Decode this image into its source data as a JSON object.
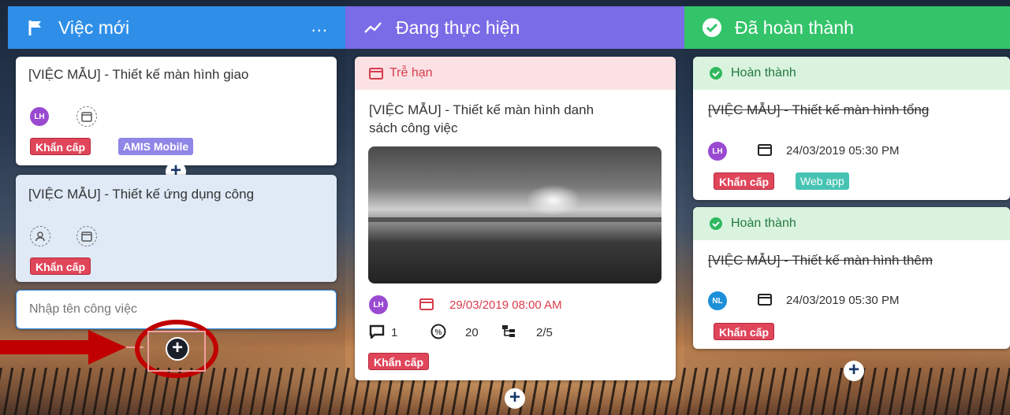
{
  "columns": [
    {
      "title": "Việc mới",
      "icon": "flag-icon",
      "more": "..."
    },
    {
      "title": "Đang thực hiện",
      "icon": "trend-icon"
    },
    {
      "title": "Đã hoàn thành",
      "icon": "check-circle-icon"
    }
  ],
  "new": {
    "card1": {
      "title": "[VIỆC MẪU] - Thiết kế màn hình giao",
      "avatar": "LH",
      "tags": [
        "Khẩn cấp",
        "AMIS Mobile"
      ]
    },
    "card2": {
      "title": "[VIỆC MẪU] - Thiết kế ứng dụng công",
      "tags": [
        "Khẩn cấp"
      ]
    },
    "input_placeholder": "Nhập tên công việc"
  },
  "progress": {
    "status": "Trễ hạn",
    "title_line1": "[VIỆC MẪU] - Thiết kế màn hình danh",
    "title_line2": "sách công việc",
    "avatar": "LH",
    "due": "29/03/2019 08:00 AM",
    "comments": "1",
    "percent": "20",
    "subtasks": "2/5",
    "tag": "Khẩn cấp"
  },
  "done": {
    "card1": {
      "status": "Hoàn thành",
      "title": "[VIỆC MẪU] - Thiết kế màn hình tổng",
      "avatar": "LH",
      "date": "24/03/2019 05:30 PM",
      "tags": [
        "Khẩn cấp",
        "Web app"
      ]
    },
    "card2": {
      "status": "Hoàn thành",
      "title": "[VIỆC MẪU] - Thiết kế màn hình thêm",
      "avatar": "NL",
      "date": "24/03/2019 05:30 PM",
      "tags": [
        "Khẩn cấp"
      ]
    }
  },
  "plus": "+",
  "colors": {
    "blue": "#2f8fe8",
    "purple": "#7a6be6",
    "green": "#33c46a",
    "urgent": "#e0455a",
    "annotation": "#c00000"
  }
}
